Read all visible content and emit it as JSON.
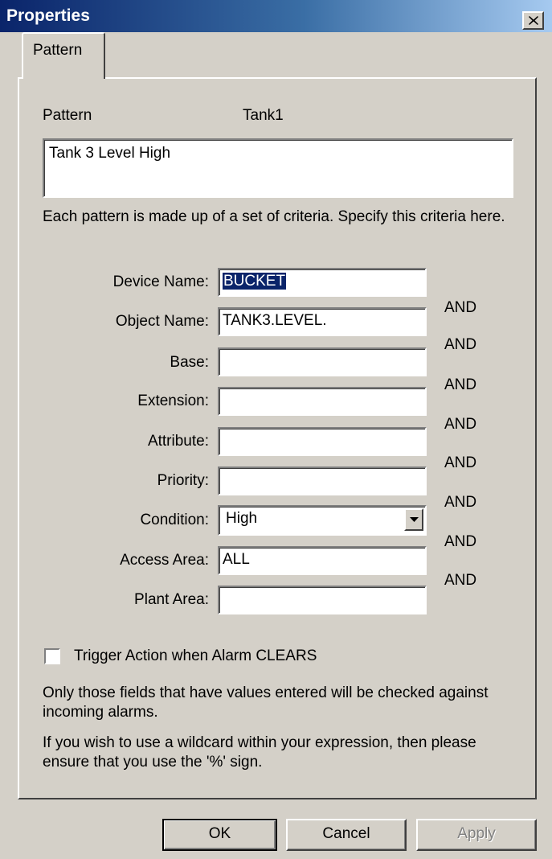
{
  "window": {
    "title": "Properties"
  },
  "tabs": [
    {
      "label": "Pattern"
    }
  ],
  "pattern": {
    "label": "Pattern",
    "name": "Tank1",
    "description": "Tank 3 Level High"
  },
  "intro_text": "Each pattern is made up of a set of criteria. Specify this criteria here.",
  "criteria": {
    "device_name": {
      "label": "Device Name:",
      "value": "BUCKET"
    },
    "object_name": {
      "label": "Object Name:",
      "value": "TANK3.LEVEL."
    },
    "base": {
      "label": "Base:",
      "value": ""
    },
    "extension": {
      "label": "Extension:",
      "value": ""
    },
    "attribute": {
      "label": "Attribute:",
      "value": ""
    },
    "priority": {
      "label": "Priority:",
      "value": ""
    },
    "condition": {
      "label": "Condition:",
      "value": "High"
    },
    "access_area": {
      "label": "Access Area:",
      "value": "ALL"
    },
    "plant_area": {
      "label": "Plant Area:",
      "value": ""
    }
  },
  "and_labels": [
    "AND",
    "AND",
    "AND",
    "AND",
    "AND",
    "AND",
    "AND",
    "AND"
  ],
  "trigger_checkbox": {
    "label": "Trigger Action when Alarm CLEARS",
    "checked": false
  },
  "note1": "Only those fields that have values entered will be checked against incoming alarms.",
  "note2": "If you wish to use a wildcard within your expression, then please ensure that you use the '%' sign.",
  "buttons": {
    "ok": "OK",
    "cancel": "Cancel",
    "apply": "Apply"
  },
  "colors": {
    "titlebar_start": "#0a246a",
    "titlebar_end": "#a6caf0",
    "face": "#d4d0c8",
    "selection": "#0a246a"
  },
  "icons": {
    "close": "close-icon",
    "dropdown": "dropdown-arrow-icon"
  }
}
